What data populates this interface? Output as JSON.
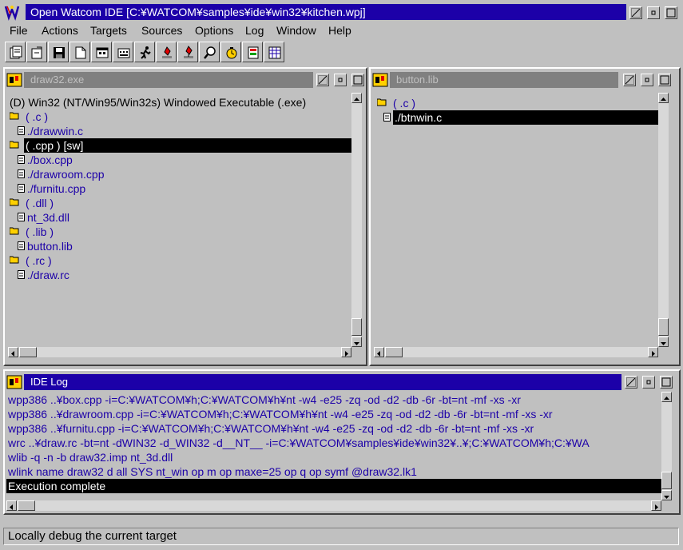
{
  "window": {
    "title": "Open Watcom IDE [C:¥WATCOM¥samples¥ide¥win32¥kitchen.wpj]"
  },
  "menu": {
    "items": [
      {
        "label": "File"
      },
      {
        "label": "Actions"
      },
      {
        "label": "Targets"
      },
      {
        "label": "Sources"
      },
      {
        "label": "Options"
      },
      {
        "label": "Log"
      },
      {
        "label": "Window"
      },
      {
        "label": "Help"
      }
    ]
  },
  "toolbar": {
    "buttons": [
      {
        "icon": "new-project-icon"
      },
      {
        "icon": "open-project-icon"
      },
      {
        "icon": "save-icon"
      },
      {
        "icon": "new-source-icon"
      },
      {
        "icon": "make-target-icon"
      },
      {
        "icon": "make-all-icon"
      },
      {
        "icon": "run-icon"
      },
      {
        "icon": "debug-icon"
      },
      {
        "icon": "remote-debug-icon"
      },
      {
        "icon": "browse-icon"
      },
      {
        "icon": "profile-icon"
      },
      {
        "icon": "edit-icon"
      },
      {
        "icon": "resource-editor-icon"
      }
    ]
  },
  "draw32": {
    "title": "draw32.exe",
    "header": "(D) Win32 (NT/Win95/Win32s) Windowed Executable (.exe)",
    "items": [
      {
        "type": "group",
        "label": "( .c )"
      },
      {
        "type": "file",
        "label": "./drawwin.c"
      },
      {
        "type": "group",
        "label": "( .cpp ) [sw]",
        "selected": true
      },
      {
        "type": "file",
        "label": "./box.cpp"
      },
      {
        "type": "file",
        "label": "./drawroom.cpp"
      },
      {
        "type": "file",
        "label": "./furnitu.cpp"
      },
      {
        "type": "group",
        "label": "( .dll )"
      },
      {
        "type": "file",
        "label": "nt_3d.dll"
      },
      {
        "type": "group",
        "label": "( .lib )"
      },
      {
        "type": "file",
        "label": "button.lib"
      },
      {
        "type": "group",
        "label": "( .rc )"
      },
      {
        "type": "file",
        "label": "./draw.rc"
      }
    ]
  },
  "buttonlib": {
    "title": "button.lib",
    "items": [
      {
        "type": "group",
        "label": "( .c )"
      },
      {
        "type": "file",
        "label": "./btnwin.c",
        "selected": true
      }
    ]
  },
  "idelog": {
    "title": "IDE Log",
    "lines": [
      {
        "text": "wpp386 ..¥box.cpp -i=C:¥WATCOM¥h;C:¥WATCOM¥h¥nt -w4 -e25 -zq -od -d2 -db -6r -bt=nt -mf -xs -xr"
      },
      {
        "text": "wpp386 ..¥drawroom.cpp -i=C:¥WATCOM¥h;C:¥WATCOM¥h¥nt -w4 -e25 -zq -od -d2 -db -6r -bt=nt -mf -xs -xr"
      },
      {
        "text": "wpp386 ..¥furnitu.cpp -i=C:¥WATCOM¥h;C:¥WATCOM¥h¥nt -w4 -e25 -zq -od -d2 -db -6r -bt=nt -mf -xs -xr"
      },
      {
        "text": "wrc ..¥draw.rc -bt=nt -dWIN32 -d_WIN32 -d__NT__ -i=C:¥WATCOM¥samples¥ide¥win32¥..¥;C:¥WATCOM¥h;C:¥WA"
      },
      {
        "text": "wlib -q -n -b draw32.imp nt_3d.dll"
      },
      {
        "text": "wlink name draw32 d all SYS nt_win op m op maxe=25 op q op symf @draw32.lk1"
      },
      {
        "text": "Execution complete",
        "selected": true
      }
    ]
  },
  "status": {
    "text": "Locally debug the current target"
  },
  "colors": {
    "active_title": "#1c00a8",
    "inactive_title": "#808080",
    "text_blue": "#1c00a8",
    "face": "#c0c0c0"
  }
}
